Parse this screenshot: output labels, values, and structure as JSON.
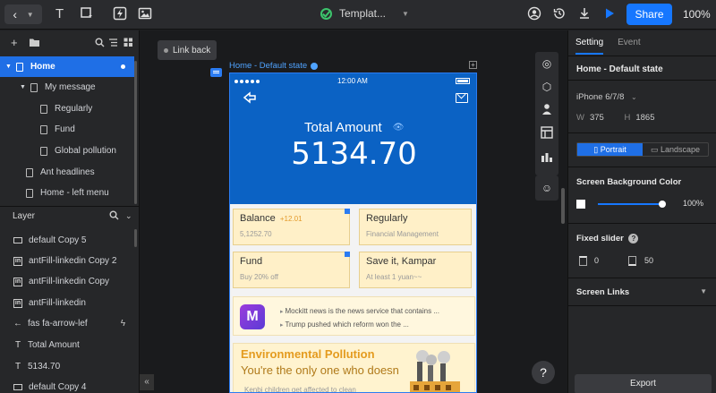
{
  "topbar": {
    "title": "Templat...",
    "share_label": "Share",
    "zoom": "100%"
  },
  "pages": [
    {
      "label": "Home",
      "selected": true
    },
    {
      "label": "My message"
    },
    {
      "label": "Regularly"
    },
    {
      "label": "Fund"
    },
    {
      "label": "Global pollution"
    },
    {
      "label": "Ant headlines"
    },
    {
      "label": "Home - left menu"
    }
  ],
  "layers": {
    "header": "Layer",
    "items": [
      {
        "label": "default Copy 5"
      },
      {
        "label": "antFill-linkedin Copy 2"
      },
      {
        "label": "antFill-linkedin Copy"
      },
      {
        "label": "antFill-linkedin"
      },
      {
        "label": "fas fa-arrow-lef"
      },
      {
        "label": "Total Amount"
      },
      {
        "label": "5134.70"
      },
      {
        "label": "default Copy 4"
      }
    ]
  },
  "canvas": {
    "link_back": "Link back",
    "state_label": "Home - Default state"
  },
  "phone": {
    "time": "12:00 AM",
    "total_label": "Total Amount",
    "total_value": "5134.70",
    "cards": [
      {
        "title": "Balance",
        "highlight": "+12.01",
        "sub": "5,1252.70"
      },
      {
        "title": "Regularly",
        "sub": "Financial Management"
      },
      {
        "title": "Fund",
        "sub": "Buy 20% off"
      },
      {
        "title": "Save it, Kampar",
        "sub": "At least 1 yuan~~"
      }
    ],
    "news": [
      "Mockitt news is the news service that contains ...",
      "Trump pushed which reform won the ..."
    ],
    "env": {
      "title": "Environmental Pollution",
      "subtitle": "You're the only one who doesn",
      "small": "Kenbi children get affected to clean"
    }
  },
  "right": {
    "tab_setting": "Setting",
    "tab_event": "Event",
    "title": "Home - Default state",
    "device": "iPhone 6/7/8",
    "width_label": "W",
    "width": "375",
    "height_label": "H",
    "height": "1865",
    "portrait": "Portrait",
    "landscape": "Landscape",
    "bg_label": "Screen Background Color",
    "bg_opacity": "100%",
    "fixed_label": "Fixed slider",
    "fixed_top": "0",
    "fixed_bottom": "50",
    "links_label": "Screen Links",
    "export": "Export"
  }
}
